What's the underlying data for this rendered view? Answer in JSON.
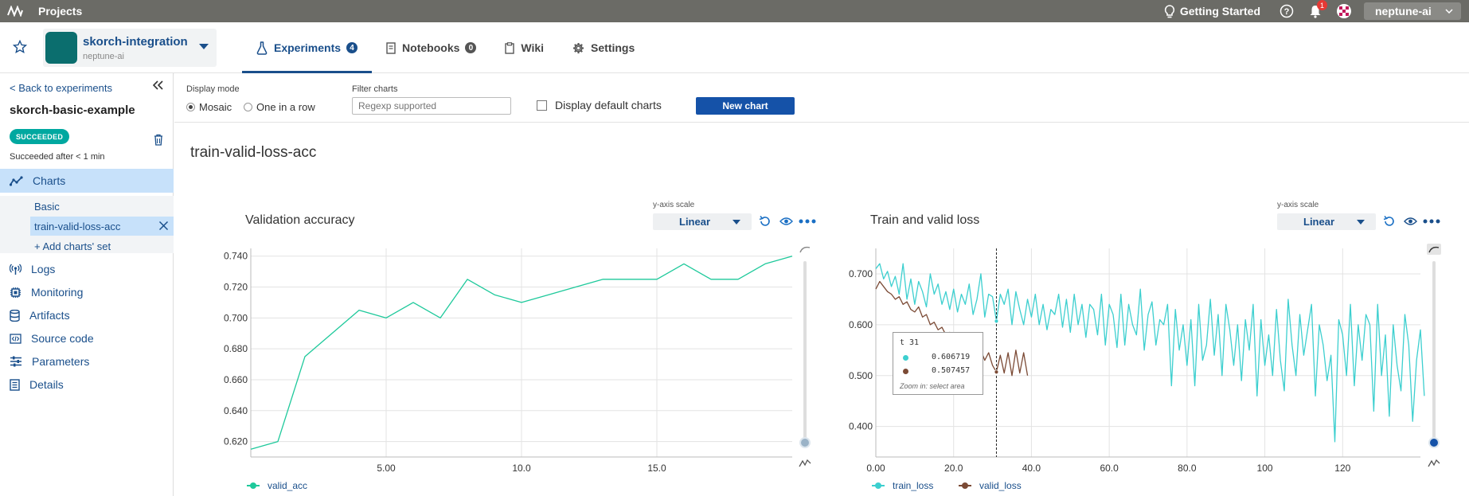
{
  "topbar": {
    "projects_label": "Projects",
    "getting_started": "Getting Started",
    "notifications_count": "1",
    "user_label": "neptune-ai"
  },
  "project": {
    "name": "skorch-integration",
    "org": "neptune-ai",
    "avatar_color": "#0b6e6e"
  },
  "tabs": [
    {
      "label": "Experiments",
      "count": "4",
      "icon": "flask-icon"
    },
    {
      "label": "Notebooks",
      "count": "0",
      "icon": "notebook-icon"
    },
    {
      "label": "Wiki",
      "icon": "wiki-icon"
    },
    {
      "label": "Settings",
      "icon": "gear-icon"
    }
  ],
  "sidebar": {
    "back_label": "< Back to experiments",
    "experiment_title": "skorch-basic-example",
    "status": "SUCCEEDED",
    "status_color": "#00a8a0",
    "status_text": "Succeeded after < 1 min",
    "nav": [
      {
        "label": "Charts",
        "icon": "chart-line-icon"
      },
      {
        "label": "Logs",
        "icon": "broadcast-icon"
      },
      {
        "label": "Monitoring",
        "icon": "chip-icon"
      },
      {
        "label": "Artifacts",
        "icon": "database-icon"
      },
      {
        "label": "Source code",
        "icon": "code-icon"
      },
      {
        "label": "Parameters",
        "icon": "sliders-icon"
      },
      {
        "label": "Details",
        "icon": "document-icon"
      }
    ],
    "chart_sets": [
      {
        "label": "Basic"
      },
      {
        "label": "train-valid-loss-acc"
      }
    ],
    "add_set_label": "+ Add charts' set"
  },
  "toolbar": {
    "display_mode_label": "Display mode",
    "mode_options": [
      "Mosaic",
      "One in a row"
    ],
    "selected_mode": "Mosaic",
    "filter_label": "Filter charts",
    "filter_placeholder": "Regexp supported",
    "default_charts_label": "Display default charts",
    "new_chart_label": "New chart"
  },
  "chart_set_title": "train-valid-loss-acc",
  "charts": {
    "left": {
      "title": "Validation accuracy",
      "yscale_label": "y-axis scale",
      "yscale_value": "Linear"
    },
    "right": {
      "title": "Train and valid loss",
      "yscale_label": "y-axis scale",
      "yscale_value": "Linear"
    }
  },
  "tooltip": {
    "key": "t 31",
    "train_value": "0.606719",
    "valid_value": "0.507457",
    "zoom_hint": "Zoom in: select area"
  },
  "chart_data": [
    {
      "type": "line",
      "title": "Validation accuracy",
      "xlabel": "",
      "ylabel": "",
      "xlim": [
        0,
        20
      ],
      "ylim": [
        0.61,
        0.745
      ],
      "xticks": [
        5.0,
        10.0,
        15.0
      ],
      "xtick_labels": [
        "5.00",
        "10.0",
        "15.0"
      ],
      "yticks": [
        0.62,
        0.64,
        0.66,
        0.68,
        0.7,
        0.72,
        0.74
      ],
      "ytick_labels": [
        "0.620",
        "0.640",
        "0.660",
        "0.680",
        "0.700",
        "0.720",
        "0.740"
      ],
      "grid": true,
      "legend": "bottom",
      "series": [
        {
          "name": "valid_acc",
          "color": "#1ec99b",
          "x": [
            0,
            1,
            2,
            3,
            4,
            5,
            6,
            7,
            8,
            9,
            10,
            11,
            12,
            13,
            14,
            15,
            16,
            17,
            18,
            19,
            20
          ],
          "values": [
            0.615,
            0.62,
            0.675,
            0.69,
            0.705,
            0.7,
            0.71,
            0.7,
            0.725,
            0.715,
            0.71,
            0.715,
            0.72,
            0.725,
            0.725,
            0.725,
            0.735,
            0.725,
            0.725,
            0.735,
            0.74
          ]
        }
      ]
    },
    {
      "type": "line",
      "title": "Train and valid loss",
      "xlabel": "",
      "ylabel": "",
      "xlim": [
        0,
        140
      ],
      "ylim": [
        0.34,
        0.75
      ],
      "xticks": [
        0,
        20,
        40,
        60,
        80,
        100,
        120
      ],
      "xtick_labels": [
        "0.00",
        "20.0",
        "40.0",
        "60.0",
        "80.0",
        "100",
        "120"
      ],
      "yticks": [
        0.4,
        0.5,
        0.6,
        0.7
      ],
      "ytick_labels": [
        "0.400",
        "0.500",
        "0.600",
        "0.700"
      ],
      "grid": true,
      "legend": "bottom",
      "hover_x": 31,
      "series": [
        {
          "name": "train_loss",
          "color": "#3ccfcf",
          "values": [
            0.71,
            0.72,
            0.69,
            0.705,
            0.675,
            0.695,
            0.66,
            0.72,
            0.65,
            0.69,
            0.64,
            0.685,
            0.665,
            0.635,
            0.7,
            0.66,
            0.68,
            0.64,
            0.665,
            0.63,
            0.67,
            0.625,
            0.66,
            0.64,
            0.68,
            0.62,
            0.65,
            0.7,
            0.615,
            0.66,
            0.655,
            0.607,
            0.66,
            0.64,
            0.67,
            0.6,
            0.665,
            0.63,
            0.6,
            0.65,
            0.615,
            0.66,
            0.6,
            0.64,
            0.59,
            0.63,
            0.62,
            0.66,
            0.595,
            0.65,
            0.585,
            0.66,
            0.6,
            0.64,
            0.575,
            0.64,
            0.63,
            0.58,
            0.66,
            0.56,
            0.64,
            0.62,
            0.555,
            0.66,
            0.56,
            0.64,
            0.6,
            0.58,
            0.67,
            0.55,
            0.62,
            0.645,
            0.56,
            0.61,
            0.6,
            0.64,
            0.48,
            0.63,
            0.55,
            0.6,
            0.52,
            0.61,
            0.48,
            0.64,
            0.53,
            0.56,
            0.65,
            0.54,
            0.62,
            0.5,
            0.64,
            0.59,
            0.52,
            0.6,
            0.49,
            0.61,
            0.55,
            0.64,
            0.46,
            0.61,
            0.52,
            0.58,
            0.5,
            0.63,
            0.53,
            0.47,
            0.65,
            0.56,
            0.5,
            0.62,
            0.54,
            0.59,
            0.64,
            0.46,
            0.6,
            0.56,
            0.49,
            0.54,
            0.37,
            0.61,
            0.58,
            0.5,
            0.64,
            0.48,
            0.6,
            0.53,
            0.62,
            0.6,
            0.43,
            0.64,
            0.5,
            0.58,
            0.42,
            0.6,
            0.52,
            0.47,
            0.62,
            0.56,
            0.41,
            0.53,
            0.59,
            0.46
          ]
        },
        {
          "name": "valid_loss",
          "color": "#7b4a35",
          "values": [
            0.67,
            0.685,
            0.675,
            0.665,
            0.66,
            0.65,
            0.655,
            0.64,
            0.645,
            0.63,
            0.625,
            0.635,
            0.615,
            0.62,
            0.6,
            0.605,
            0.59,
            0.595,
            0.58,
            0.585,
            0.575,
            0.565,
            0.58,
            0.555,
            0.545,
            0.56,
            0.54,
            0.55,
            0.53,
            0.545,
            0.52,
            0.507,
            0.54,
            0.505,
            0.545,
            0.5,
            0.55,
            0.505,
            0.545,
            0.5
          ]
        }
      ]
    }
  ]
}
